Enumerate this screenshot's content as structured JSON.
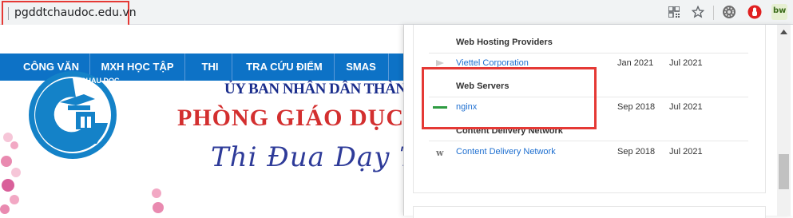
{
  "browser": {
    "url": "pgddtchaudoc.edu.vn",
    "icons": [
      "qr-code-icon",
      "bookmark-star-icon",
      "extension-gear-icon",
      "stop-hand-icon",
      "builtwith-icon"
    ],
    "builtwith_label": "bw"
  },
  "site": {
    "nav_items": [
      "CÔNG VĂN",
      "MXH HỌC TẬP",
      "THI",
      "TRA CỨU ĐIỂM",
      "SMAS"
    ],
    "logo_text": "CHAU DOC",
    "header_line1": "ỦY BAN NHÂN DÂN THÀNH PH",
    "header_line2": "PHÒNG GIÁO DỤC V",
    "header_line3": "Thi Đua Dạy Tốt",
    "stray_char": "i",
    "colors": {
      "nav_bg": "#0d72c6",
      "title_red": "#d32f2f",
      "title_blue": "#1a2d8c"
    }
  },
  "panel": {
    "sections": [
      {
        "title": "Web Hosting Providers",
        "rows": [
          {
            "name": "Viettel Corporation",
            "first": "Jan 2021",
            "last": "Jul 2021",
            "icon": "viettel-icon"
          }
        ]
      },
      {
        "title": "Web Servers",
        "rows": [
          {
            "name": "nginx",
            "first": "Sep 2018",
            "last": "Jul 2021",
            "icon": "nginx-icon"
          }
        ]
      },
      {
        "title": "Content Delivery Network",
        "rows": [
          {
            "name": "Content Delivery Network",
            "first": "Sep 2018",
            "last": "Jul 2021",
            "icon": "cdn-w-icon"
          }
        ]
      }
    ],
    "highlight_color": "#e53935"
  }
}
